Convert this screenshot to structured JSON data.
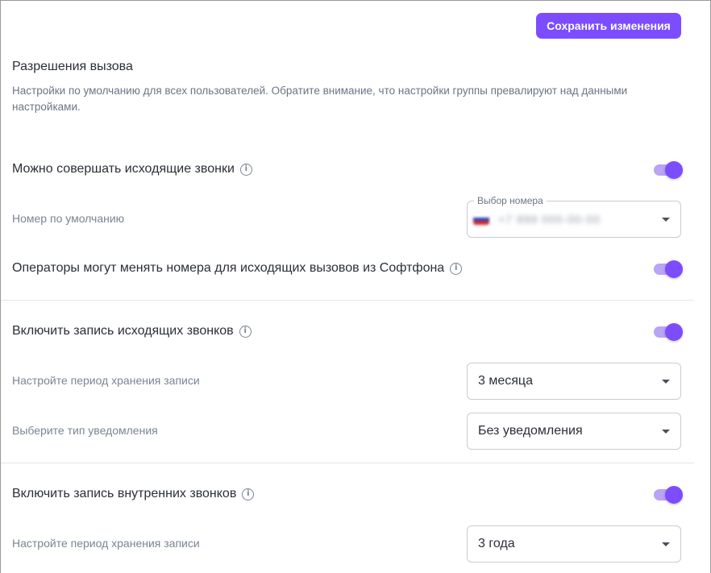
{
  "toolbar": {
    "save_label": "Сохранить изменения"
  },
  "section": {
    "title": "Разрешения вызова",
    "description": "Настройки по умолчанию для всех пользователей. Обратите внимание, что настройки группы превалируют над данными настройками."
  },
  "outgoing": {
    "label": "Можно совершать исходящие звонки",
    "enabled": true,
    "default_number_label": "Номер по умолчанию",
    "number_select": {
      "legend": "Выбор номера",
      "value": "+7 999 000-00-00"
    }
  },
  "change_numbers": {
    "label": "Операторы могут менять номера для исходящих вызовов из Софтфона",
    "enabled": true
  },
  "outgoing_recording": {
    "label": "Включить запись исходящих звонков",
    "enabled": true,
    "retention_label": "Настройте период хранения записи",
    "retention_value": "3 месяца",
    "notification_label": "Выберите тип уведомления",
    "notification_value": "Без уведомления"
  },
  "internal_recording": {
    "label": "Включить запись внутренних звонков",
    "enabled": true,
    "retention_label": "Настройте период хранения записи",
    "retention_value": "3 года"
  },
  "colors": {
    "accent": "#7c4dff",
    "accent_light": "#b9a4f5",
    "muted_text": "#7a8494"
  },
  "icons": {
    "info": "info-icon",
    "dropdown": "chevron-down-icon",
    "flag": "flag-icon"
  }
}
